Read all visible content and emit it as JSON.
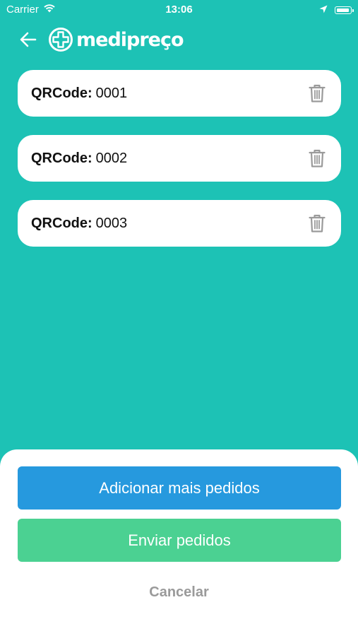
{
  "status_bar": {
    "carrier": "Carrier",
    "time": "13:06",
    "icons": [
      "wifi-icon",
      "location-arrow-icon",
      "battery-icon"
    ]
  },
  "header": {
    "back_icon": "arrow-left-icon",
    "logo_text": "medipreço",
    "logo_icon": "medical-cross-icon"
  },
  "qr_items": [
    {
      "label": "QRCode:",
      "value": "0001",
      "icon": "trash-icon"
    },
    {
      "label": "QRCode:",
      "value": "0002",
      "icon": "trash-icon"
    },
    {
      "label": "QRCode:",
      "value": "0003",
      "icon": "trash-icon"
    }
  ],
  "actions": {
    "add_label": "Adicionar mais pedidos",
    "send_label": "Enviar pedidos",
    "cancel_label": "Cancelar"
  },
  "colors": {
    "background": "#1dc2b5",
    "add_button": "#2699de",
    "send_button": "#4bd192",
    "cancel_text": "#9a9a9a",
    "trash_icon": "#9a9a9a"
  }
}
